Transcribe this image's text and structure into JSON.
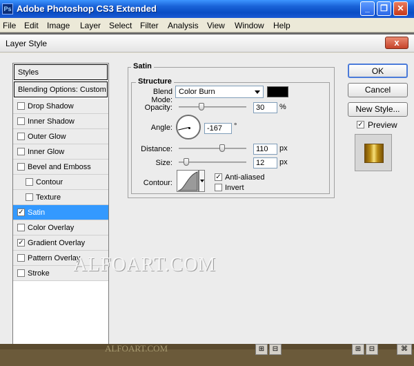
{
  "app": {
    "title": "Adobe Photoshop CS3 Extended",
    "icon_text": "Ps",
    "window_controls": [
      "minimize-icon",
      "restore-icon",
      "close-icon"
    ]
  },
  "menu": [
    "File",
    "Edit",
    "Image",
    "Layer",
    "Select",
    "Filter",
    "Analysis",
    "View",
    "Window",
    "Help"
  ],
  "dialog": {
    "title": "Layer Style",
    "close_label": "x"
  },
  "styles_list": {
    "header": "Styles",
    "blending": "Blending Options: Custom",
    "items": [
      {
        "label": "Drop Shadow",
        "checked": false,
        "sub": false,
        "selected": false
      },
      {
        "label": "Inner Shadow",
        "checked": false,
        "sub": false,
        "selected": false
      },
      {
        "label": "Outer Glow",
        "checked": false,
        "sub": false,
        "selected": false
      },
      {
        "label": "Inner Glow",
        "checked": false,
        "sub": false,
        "selected": false
      },
      {
        "label": "Bevel and Emboss",
        "checked": false,
        "sub": false,
        "selected": false
      },
      {
        "label": "Contour",
        "checked": false,
        "sub": true,
        "selected": false
      },
      {
        "label": "Texture",
        "checked": false,
        "sub": true,
        "selected": false
      },
      {
        "label": "Satin",
        "checked": true,
        "sub": false,
        "selected": true
      },
      {
        "label": "Color Overlay",
        "checked": false,
        "sub": false,
        "selected": false
      },
      {
        "label": "Gradient Overlay",
        "checked": true,
        "sub": false,
        "selected": false
      },
      {
        "label": "Pattern Overlay",
        "checked": false,
        "sub": false,
        "selected": false
      },
      {
        "label": "Stroke",
        "checked": false,
        "sub": false,
        "selected": false
      }
    ]
  },
  "satin": {
    "title": "Satin",
    "structure_title": "Structure",
    "blend_mode_label": "Blend Mode:",
    "blend_mode_value": "Color Burn",
    "color": "#000000",
    "opacity_label": "Opacity:",
    "opacity_value": "30",
    "opacity_unit": "%",
    "opacity_fraction": 0.3,
    "angle_label": "Angle:",
    "angle_value": "-167",
    "angle_unit": "°",
    "distance_label": "Distance:",
    "distance_value": "110",
    "distance_unit": "px",
    "size_label": "Size:",
    "size_value": "12",
    "size_unit": "px",
    "contour_label": "Contour:",
    "anti_aliased_label": "Anti-aliased",
    "anti_aliased_checked": true,
    "invert_label": "Invert",
    "invert_checked": false
  },
  "buttons": {
    "ok": "OK",
    "cancel": "Cancel",
    "new_style": "New Style...",
    "preview_label": "Preview",
    "preview_checked": true
  },
  "watermark": "ALFOART.COM",
  "watermark_small": "ALFOART.COM",
  "check_mark": "✓"
}
